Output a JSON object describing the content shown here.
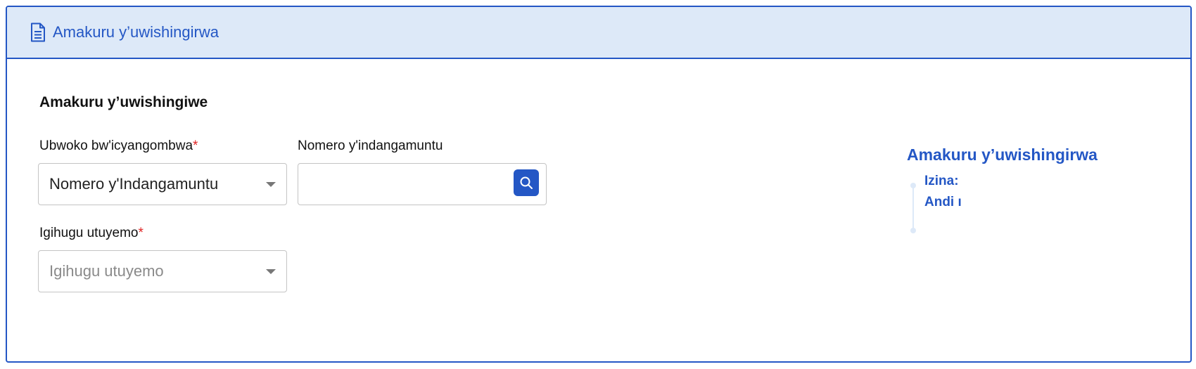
{
  "header": {
    "icon": "document-icon",
    "title": "Amakuru y’uwishingirwa"
  },
  "section": {
    "title": "Amakuru y’uwishingiwe"
  },
  "fields": {
    "document_type": {
      "label": "Ubwoko bw'icyangombwa",
      "required_mark": "*",
      "value": "Nomero y'Indangamuntu"
    },
    "id_number": {
      "label": "Nomero y'indangamuntu",
      "value": "",
      "search_icon": "search-icon"
    },
    "country": {
      "label": "Igihugu utuyemo",
      "required_mark": "*",
      "placeholder": "Igihugu utuyemo"
    }
  },
  "info_panel": {
    "title": "Amakuru y’uwishingirwa",
    "name_label": "Izina:",
    "other_label": "Andi ı"
  },
  "colors": {
    "primary": "#2457c5",
    "header_bg": "#dde9f8",
    "required": "#e02424",
    "border": "#c4c4c4",
    "placeholder": "#8a8a8a"
  }
}
